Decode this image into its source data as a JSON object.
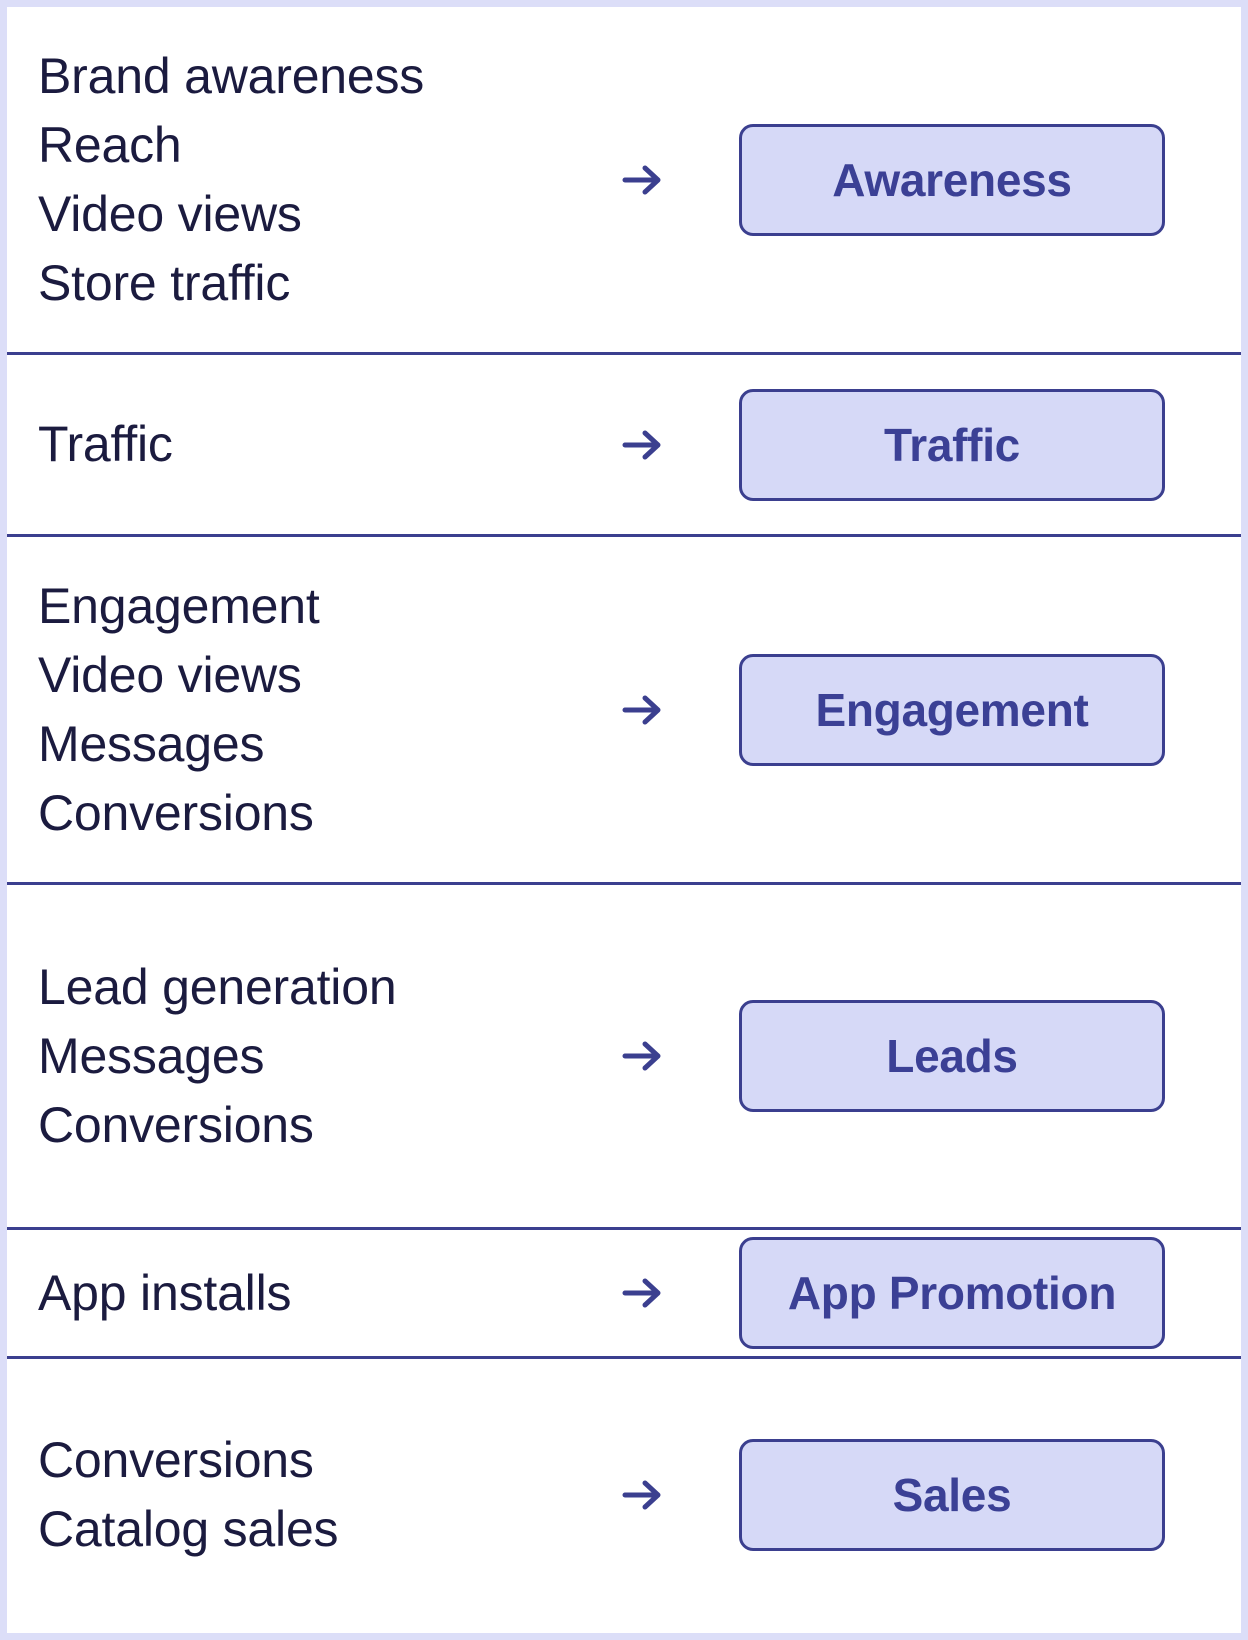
{
  "colors": {
    "page_border": "#dcdef8",
    "divider": "#3b3f8f",
    "objective_text": "#1b1b3f",
    "badge_fill": "#d6d9f7",
    "badge_border": "#3b3f8f",
    "badge_text": "#3b4095",
    "arrow": "#3b3f8f"
  },
  "arrow_icon": "arrow-right-icon",
  "rows": [
    {
      "objectives": [
        "Brand awareness",
        "Reach",
        "Video views",
        "Store traffic"
      ],
      "badge": "Awareness"
    },
    {
      "objectives": [
        "Traffic"
      ],
      "badge": "Traffic"
    },
    {
      "objectives": [
        "Engagement",
        "Video views",
        "Messages",
        "Conversions"
      ],
      "badge": "Engagement"
    },
    {
      "objectives": [
        "Lead generation",
        "Messages",
        "Conversions"
      ],
      "badge": "Leads"
    },
    {
      "objectives": [
        "App installs"
      ],
      "badge": "App Promotion"
    },
    {
      "objectives": [
        "Conversions",
        "Catalog sales"
      ],
      "badge": "Sales"
    }
  ]
}
